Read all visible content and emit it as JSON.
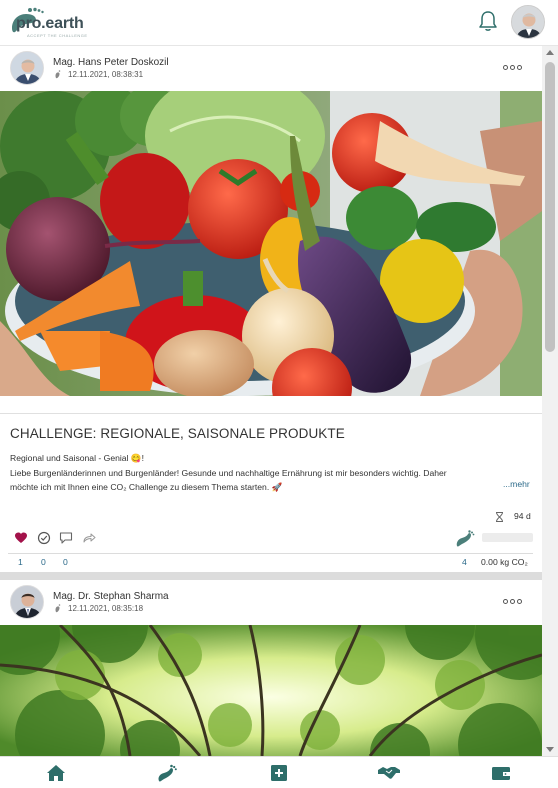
{
  "app": {
    "logo_text": "pro.earth",
    "logo_sub": "ACCEPT THE CHALLENGE"
  },
  "colors": {
    "accent": "#2e6e6a",
    "like": "#a3124a",
    "link": "#2c6a8a"
  },
  "posts": [
    {
      "author": "Mag. Hans Peter Doskozil",
      "date": "12.11.2021, 08:38:31",
      "image": "vegetables-bowl",
      "title": "CHALLENGE: REGIONALE, SAISONALE PRODUKTE",
      "text_line1": "Regional und Saisonal - Genial 😋!",
      "text_line2": "Liebe Burgenländerinnen und Burgenländer! Gesunde und nachhaltige Ernährung ist mir besonders wichtig. Daher",
      "text_line3": "möchte ich mit Ihnen eine CO₂ Challenge zu diesem Thema starten. 🚀",
      "more_link": "...mehr",
      "days_left": "94 d",
      "count_likes": "1",
      "count_checks": "0",
      "count_comments": "0",
      "participants": "4",
      "co2": "0.00 kg CO₂"
    },
    {
      "author": "Mag. Dr. Stephan Sharma",
      "date": "12.11.2021, 08:35:18",
      "image": "forest-canopy"
    }
  ],
  "icons": {
    "bell": "bell-icon",
    "home": "home-icon",
    "footprint": "footprint-icon",
    "add": "plus-square-icon",
    "handshake": "handshake-icon",
    "wallet": "wallet-icon"
  }
}
